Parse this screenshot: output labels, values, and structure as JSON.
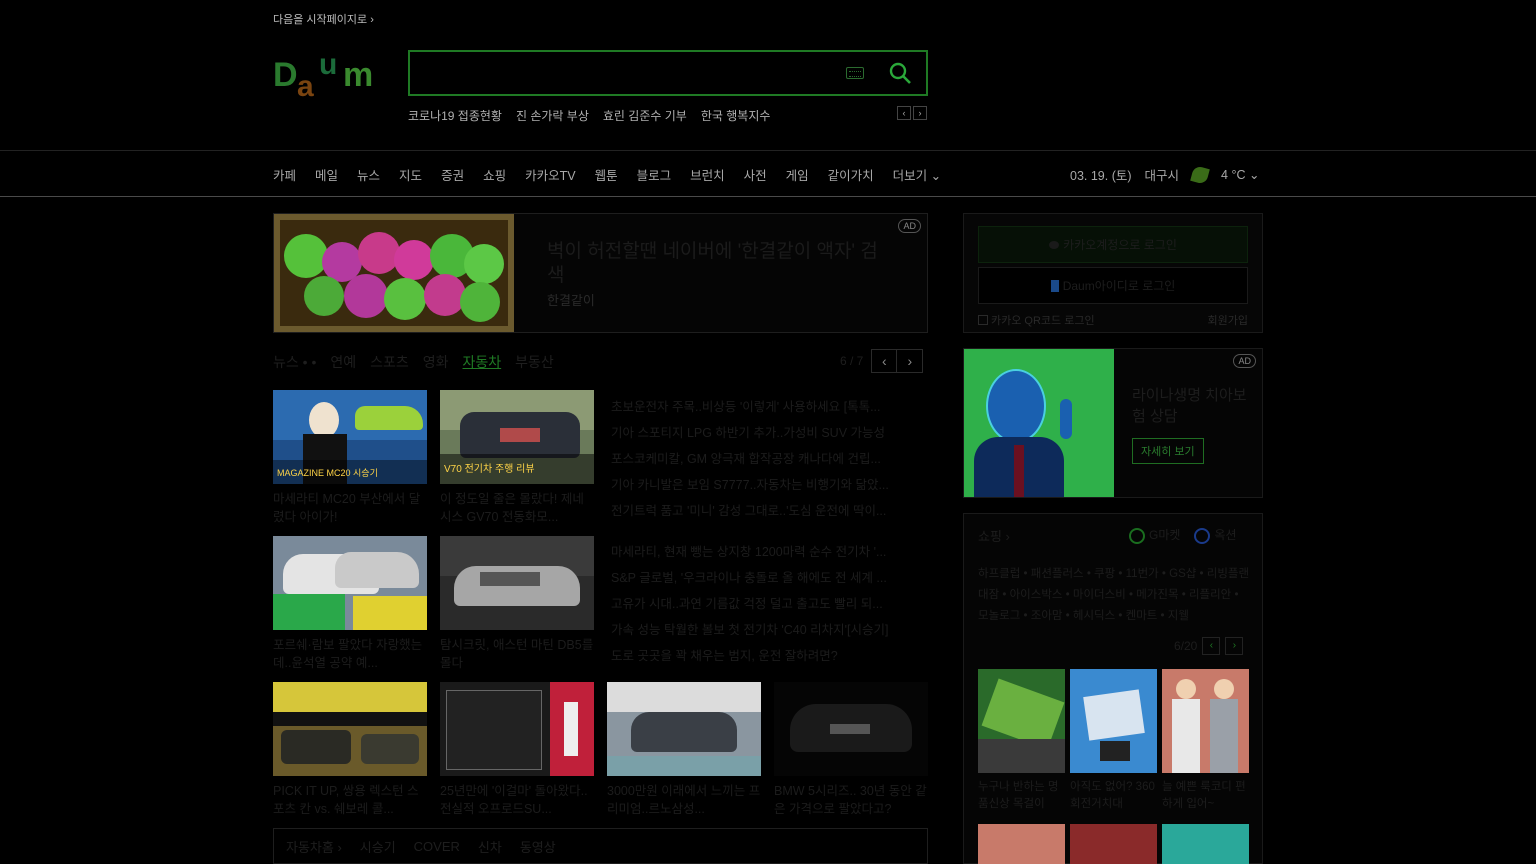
{
  "top": {
    "start_link": "다음을 시작페이지로 ›"
  },
  "search": {
    "placeholder": "",
    "trends": [
      "코로나19 접종현황",
      "진 손가락 부상",
      "효린 김준수 기부",
      "한국 행복지수"
    ],
    "prev": "‹",
    "next": "›"
  },
  "nav": {
    "items": [
      "카페",
      "메일",
      "뉴스",
      "지도",
      "증권",
      "쇼핑",
      "카카오TV",
      "웹툰",
      "블로그",
      "브런치",
      "사전",
      "게임",
      "같이가치",
      "더보기 ⌄"
    ]
  },
  "weather": {
    "date": "03. 19. (토)",
    "city": "대구시",
    "temp": "4 °C ⌄"
  },
  "ad_banner": {
    "tag": "AD",
    "title": "벽이 허전할땐 네이버에 '한결같이 액자' 검색",
    "sub": "한결같이"
  },
  "news": {
    "tabs": [
      "뉴스 • •",
      "연예",
      "스포츠",
      "영화",
      "자동차",
      "부동산"
    ],
    "active": "자동차",
    "page": "6 / 7",
    "cards": [
      {
        "title": "마세라티 MC20 부산에서 달렸다 아이가!"
      },
      {
        "title": "이 정도일 줄은 몰랐다! 제네시스 GV70 전동화모..."
      },
      {
        "title": "포르쉐·람보 팔았다 자랑했는데..윤석열 공약 예..."
      },
      {
        "title": "탐시크릿, 애스턴 마틴 DB5를 몰다"
      },
      {
        "title": "PICK IT UP, 쌍용 렉스턴 스포츠 칸 vs. 쉐보레 콜..."
      },
      {
        "title": "25년만에 '이걸마' 돌아왔다..전실적 오프로드SU..."
      },
      {
        "title": "3000만원 이래에서 느끼는 프리미엄..르노삼성..."
      },
      {
        "title": "BMW 5시리즈.. 30년 동안 같은 가격으로 팔았다고?"
      }
    ],
    "headlines": [
      "초보운전자 주목..비상등 '이렇게' 사용하세요 [톡톡...",
      "기아 스포티지 LPG 하반기 추가..가성비 SUV 가능성",
      "포스코케미칼, GM 양극재 합작공장 캐나다에 건립...",
      "기아 카니발은 보임 S7777..자동차는 비행기와 닮았...",
      "전기트럭 품고 '미니' 감성 그대로..'도심 운전에 딱이...",
      "마세라티, 현재 뺑는 상지창 1200마력 순수 전기차 '...",
      "S&P 글로벌, '우크라이나 충돌로 올 해에도 전 세계 ...",
      "고유가 시대..과연 기름값 걱정 덜고 출고도 빨리 되...",
      "가속 성능 탁월한 볼보 첫 전기차 'C40 리차지'[시승기]",
      "도로 곳곳을 꽉 채우는 범지, 운전 잘하려면?"
    ],
    "thumb_caption1": "MAGAZINE MC20 시승기",
    "thumb_caption2": "V70 전기차 주행 리뷰"
  },
  "bottom_tabs": [
    "자동차홈 ›",
    "시승기",
    "COVER",
    "신차",
    "동영상"
  ],
  "login": {
    "kakao": "카카오계정으로 로그인",
    "daum": "Daum아이디로 로그인",
    "qr": "카카오 QR코드 로그인",
    "join": "회원가입"
  },
  "ad_side": {
    "tag": "AD",
    "title": "라이나생명 치아보험 상담",
    "button": "자세히 보기"
  },
  "shopping": {
    "title": "쇼핑 ›",
    "gmarket": "G마켓",
    "auction": "옥션",
    "brands": "하프클럽 • 패션플러스 • 쿠팡 • 11번가 • GS샵 • 리빙플랜대잠 • 아이스박스 • 마이더스비 • 메가진목 • 리플리안 • 모놀로그 • 조아맘 • 헤시딕스 • 켄마트 • 지웰",
    "page": "6/20",
    "items": [
      {
        "title": "누구나 반하는 명품신상 목걸이"
      },
      {
        "title": "아직도 없어? 360회전거치대"
      },
      {
        "title": "늘 예쁜 룩코디 편하게 입어~"
      }
    ]
  },
  "colors": {
    "accent": "#1f7a24",
    "background": "#000000"
  }
}
